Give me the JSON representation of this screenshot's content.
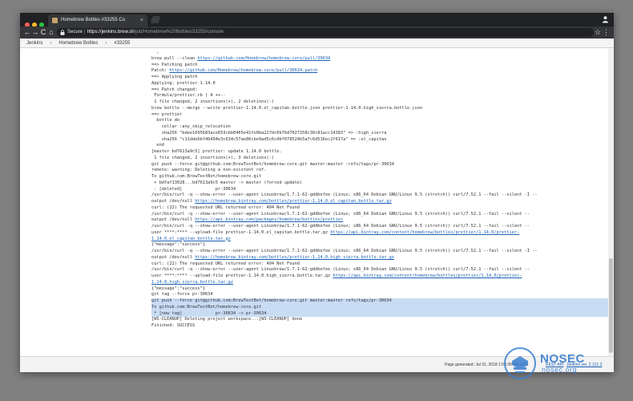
{
  "browser": {
    "tab_title": "Homebrew Bottles #33255 Co",
    "tab_close": "×",
    "back_glyph": "←",
    "forward_glyph": "→",
    "reload_glyph": "C",
    "home_glyph": "⌂",
    "secure_label": "Secure",
    "separator": "|",
    "url_host": "https://jenkins.brew.sh",
    "url_path": "/job/Homebrew%20Bottles/33255/console",
    "star_glyph": "☆",
    "menu_glyph": "⋮"
  },
  "breadcrumb": {
    "items": [
      "Jenkins",
      "Homebrew Bottles",
      "#33255"
    ],
    "separator": "›"
  },
  "console": {
    "lines": [
      {
        "parts": [
          {
            "t": "  ,"
          }
        ]
      },
      {
        "parts": [
          {
            "t": "brew pull --clean "
          },
          {
            "t": "https://github.com/Homebrew/homebrew-core/pull/30634",
            "link": true
          }
        ]
      },
      {
        "parts": [
          {
            "t": "==> Patching patch"
          }
        ]
      },
      {
        "parts": [
          {
            "t": "Patch: "
          },
          {
            "t": "https://github.com/Homebrew/homebrew-core/pull/30634.patch",
            "link": true
          }
        ]
      },
      {
        "parts": [
          {
            "t": "==> Applying patch"
          }
        ]
      },
      {
        "parts": [
          {
            "t": "Applying: prettier 1.14.0"
          }
        ]
      },
      {
        "parts": [
          {
            "t": "==> Patch changed:"
          }
        ]
      },
      {
        "parts": [
          {
            "t": " Formula/prettier.rb | 4 ++--"
          }
        ]
      },
      {
        "parts": [
          {
            "t": " 1 file changed, 2 insertions(+), 2 deletions(-)"
          }
        ]
      },
      {
        "parts": [
          {
            "t": "brew bottle --merge --write prettier-1.14.0.el_capitan.bottle.json prettier-1.14.0.high_sierra.bottle.json"
          }
        ]
      },
      {
        "parts": [
          {
            "t": "==> prettier"
          }
        ]
      },
      {
        "parts": [
          {
            "t": "  bottle do"
          }
        ]
      },
      {
        "parts": [
          {
            "t": "    cellar :any_skip_relocation"
          }
        ]
      },
      {
        "parts": [
          {
            "t": "    sha256 \"bdee1695683ace653cbb0465e41fe0ba227dc0b76d7027258c30c81acc14383\" => :high_sierra"
          }
        ]
      },
      {
        "parts": [
          {
            "t": "    sha256 \"c11dde6bf46494e3c634c57ae86cbe9ad5c6c4bf078524b5a7c6d516ec2f617a\" => :el_capitan"
          }
        ]
      },
      {
        "parts": [
          {
            "t": "  end"
          }
        ]
      },
      {
        "parts": [
          {
            "t": "[master bd7613a9c5] prettier: update 1.14.0 bottle."
          }
        ]
      },
      {
        "parts": [
          {
            "t": " 1 file changed, 2 insertions(+), 3 deletions(-)"
          }
        ]
      },
      {
        "parts": [
          {
            "t": "git push --force git@github.com:BrewTestBot/homebrew-core.git master:master :refs/tags/pr-30634"
          }
        ]
      },
      {
        "parts": [
          {
            "t": "remote: warning: Deleting a non-existent ref."
          }
        ]
      },
      {
        "parts": [
          {
            "t": "To github.com:BrewTestBot/homebrew-core.git"
          }
        ]
      },
      {
        "parts": [
          {
            "t": " + bdfaf13028...bd7613a9c5 master -> master (forced update)"
          }
        ]
      },
      {
        "parts": [
          {
            "t": " - [deleted]             pr-30634"
          }
        ]
      },
      {
        "parts": [
          {
            "t": "/usr/bin/curl -q --show-error --user-agent Linuxbrew/1.7.1-62-gddbefee (Linux; x86_64 Debian GNU/Linux 9.5 (stretch)) curl/7.52.1 --fail --silent -I --"
          }
        ]
      },
      {
        "parts": [
          {
            "t": "output /dev/null "
          },
          {
            "t": "https://homebrew.bintray.com/bottles/prettier-1.14.0.el_capitan.bottle.tar.gz",
            "link": true
          }
        ]
      },
      {
        "parts": [
          {
            "t": "curl: (22) The requested URL returned error: 404 Not Found"
          }
        ]
      },
      {
        "parts": [
          {
            "t": "/usr/bin/curl -q --show-error --user-agent Linuxbrew/1.7.1-62-gddbefee (Linux; x86_64 Debian GNU/Linux 9.5 (stretch)) curl/7.52.1 --fail --silent --"
          }
        ]
      },
      {
        "parts": [
          {
            "t": "output /dev/null "
          },
          {
            "t": "https://api.bintray.com/packages/homebrew/bottles/prettier",
            "link": true
          }
        ]
      },
      {
        "parts": [
          {
            "t": "/usr/bin/curl -q --show-error --user-agent Linuxbrew/1.7.1-62-gddbefee (Linux; x86_64 Debian GNU/Linux 9.5 (stretch)) curl/7.52.1 --fail --silent --"
          }
        ]
      },
      {
        "parts": [
          {
            "t": "user ****:**** --upload-file prettier-1.14.0.el_capitan.bottle.tar.gz "
          },
          {
            "t": "https://api.bintray.com/content/homebrew/bottles/prettier/1.14.0/prettier-",
            "link": true
          }
        ]
      },
      {
        "parts": [
          {
            "t": "1.14.0.el_capitan.bottle.tar.gz",
            "link": true
          }
        ]
      },
      {
        "parts": [
          {
            "t": "{\"message\":\"success\"}"
          }
        ]
      },
      {
        "parts": [
          {
            "t": "/usr/bin/curl -q --show-error --user-agent Linuxbrew/1.7.1-62-gddbefee (Linux; x86_64 Debian GNU/Linux 9.5 (stretch)) curl/7.52.1 --fail --silent -I --"
          }
        ]
      },
      {
        "parts": [
          {
            "t": "output /dev/null "
          },
          {
            "t": "https://homebrew.bintray.com/bottles/prettier-1.14.0.high_sierra.bottle.tar.gz",
            "link": true
          }
        ]
      },
      {
        "parts": [
          {
            "t": "curl: (22) The requested URL returned error: 404 Not Found"
          }
        ]
      },
      {
        "parts": [
          {
            "t": "/usr/bin/curl -q --show-error --user-agent Linuxbrew/1.7.1-62-gddbefee (Linux; x86_64 Debian GNU/Linux 9.5 (stretch)) curl/7.52.1 --fail --silent --"
          }
        ]
      },
      {
        "parts": [
          {
            "t": "user ****:**** --upload-file prettier-1.14.0.high_sierra.bottle.tar.gz "
          },
          {
            "t": "https://api.bintray.com/content/homebrew/bottles/prettier/1.14.0/prettier-",
            "link": true
          }
        ]
      },
      {
        "parts": [
          {
            "t": "1.14.0.high_sierra.bottle.tar.gz",
            "link": true
          }
        ]
      },
      {
        "parts": [
          {
            "t": "{\"message\":\"success\"}"
          }
        ]
      },
      {
        "parts": [
          {
            "t": "git tag --force pr-30634"
          }
        ]
      },
      {
        "parts": [
          {
            "t": "git push --force git@github.com:BrewTestBot/homebrew-core.git master:master refs/tags/pr-30634"
          }
        ],
        "hl": true
      },
      {
        "parts": [
          {
            "t": "To github.com:BrewTestBot/homebrew-core.git"
          }
        ],
        "hl": true
      },
      {
        "parts": [
          {
            "t": " * [new tag]             pr-30634 -> pr-30634"
          }
        ],
        "hl": true
      },
      {
        "parts": [
          {
            "t": "[WS-CLEANUP] Deleting project workspace...[WS-CLEANUP] done"
          }
        ]
      },
      {
        "parts": [
          {
            "t": "Finished: SUCCESS"
          }
        ]
      }
    ]
  },
  "footer": {
    "generated": "Page generated: Jul 31, 2018 1:53:39 PM UTC",
    "rest_api": "REST API",
    "jenkins_ver": "Jenkins ver. 2.121.2"
  },
  "watermark": {
    "title": "NOSEC",
    "subtitle": "nosec.org"
  },
  "colors": {
    "link": "#1a5fb4",
    "highlight": "#c8dcf4",
    "chrome_dark": "#202124"
  }
}
